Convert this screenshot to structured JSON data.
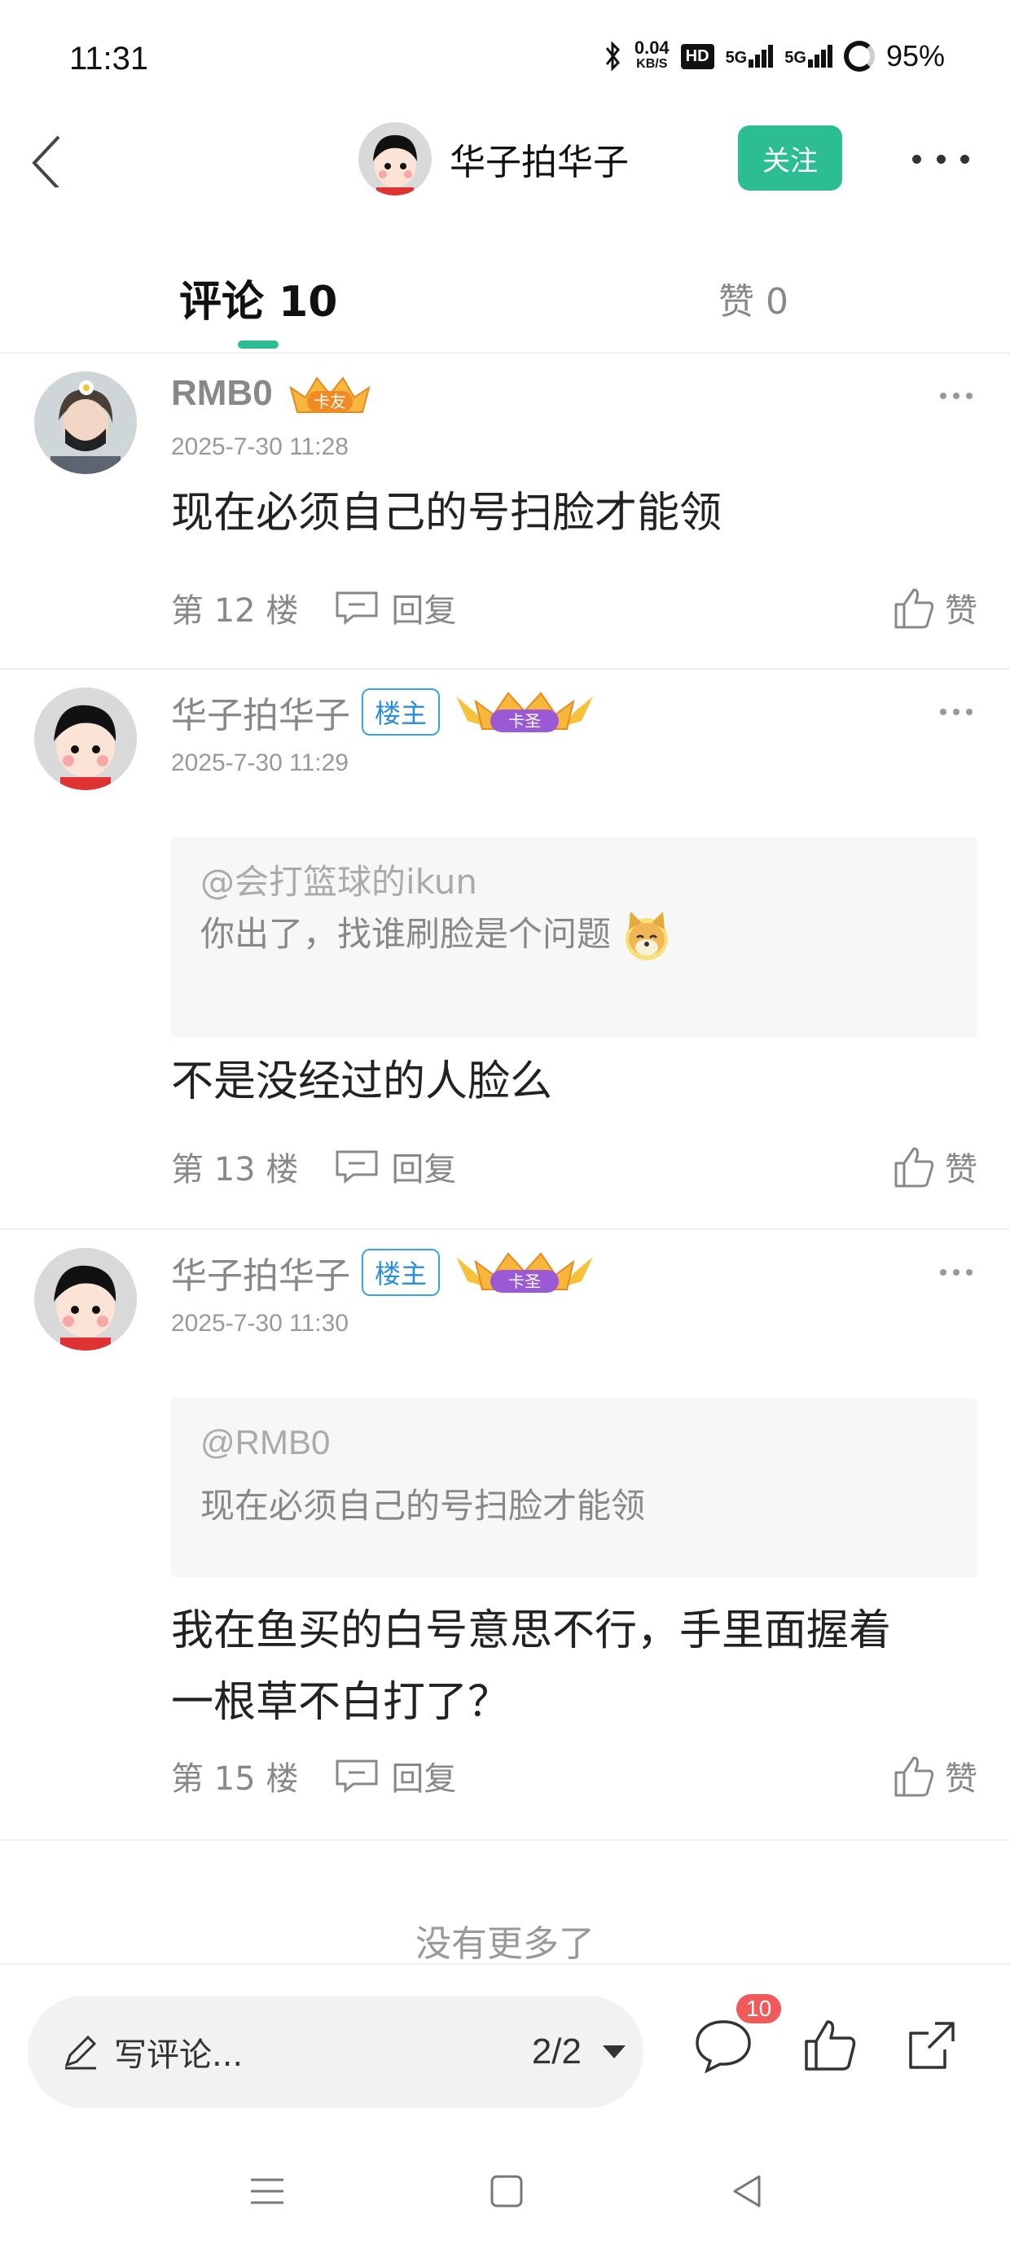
{
  "status_bar": {
    "time": "11:31",
    "net_speed_value": "0.04",
    "net_speed_unit": "KB/S",
    "hd": "HD",
    "sim1": "5G",
    "sim2": "5G",
    "battery": "95%"
  },
  "header": {
    "user_name": "华子拍华子",
    "follow_label": "关注"
  },
  "tabs": {
    "comments_label": "评论 10",
    "likes_label": "赞 0",
    "active": "comments"
  },
  "comments": [
    {
      "name": "RMB0",
      "medal_label": "卡友",
      "time": "2025-7-30 11:28",
      "body": "现在必须自己的号扫脸才能领",
      "floor": "第 12 楼",
      "reply_label": "回复",
      "like_label": "赞"
    },
    {
      "name": "华子拍华子",
      "owner_badge": "楼主",
      "medal_label": "卡圣",
      "time": "2025-7-30 11:29",
      "quote_at": "@会打篮球的ikun",
      "quote_text": "你出了，找谁刷脸是个问题",
      "body": "不是没经过的人脸么",
      "floor": "第 13 楼",
      "reply_label": "回复",
      "like_label": "赞"
    },
    {
      "name": "华子拍华子",
      "owner_badge": "楼主",
      "medal_label": "卡圣",
      "time": "2025-7-30 11:30",
      "quote_at": "@RMB0",
      "quote_text": "现在必须自己的号扫脸才能领",
      "body_line1": "我在鱼买的白号意思不行，手里面握着",
      "body_line2": "一根草不白打了？",
      "floor": "第 15 楼",
      "reply_label": "回复",
      "like_label": "赞"
    }
  ],
  "no_more": "没有更多了",
  "bottom_bar": {
    "write_placeholder": "写评论...",
    "page_indicator": "2/2",
    "comment_count": "10"
  },
  "colors": {
    "accent": "#2dbd93",
    "badge_red": "#f05a5a",
    "owner_blue": "#2a8ed6"
  },
  "icons": [
    "back-icon",
    "more-icon",
    "comment-icon",
    "thumb-up-icon",
    "share-icon",
    "pencil-icon",
    "menu-nav-icon",
    "home-nav-icon",
    "back-nav-icon"
  ]
}
